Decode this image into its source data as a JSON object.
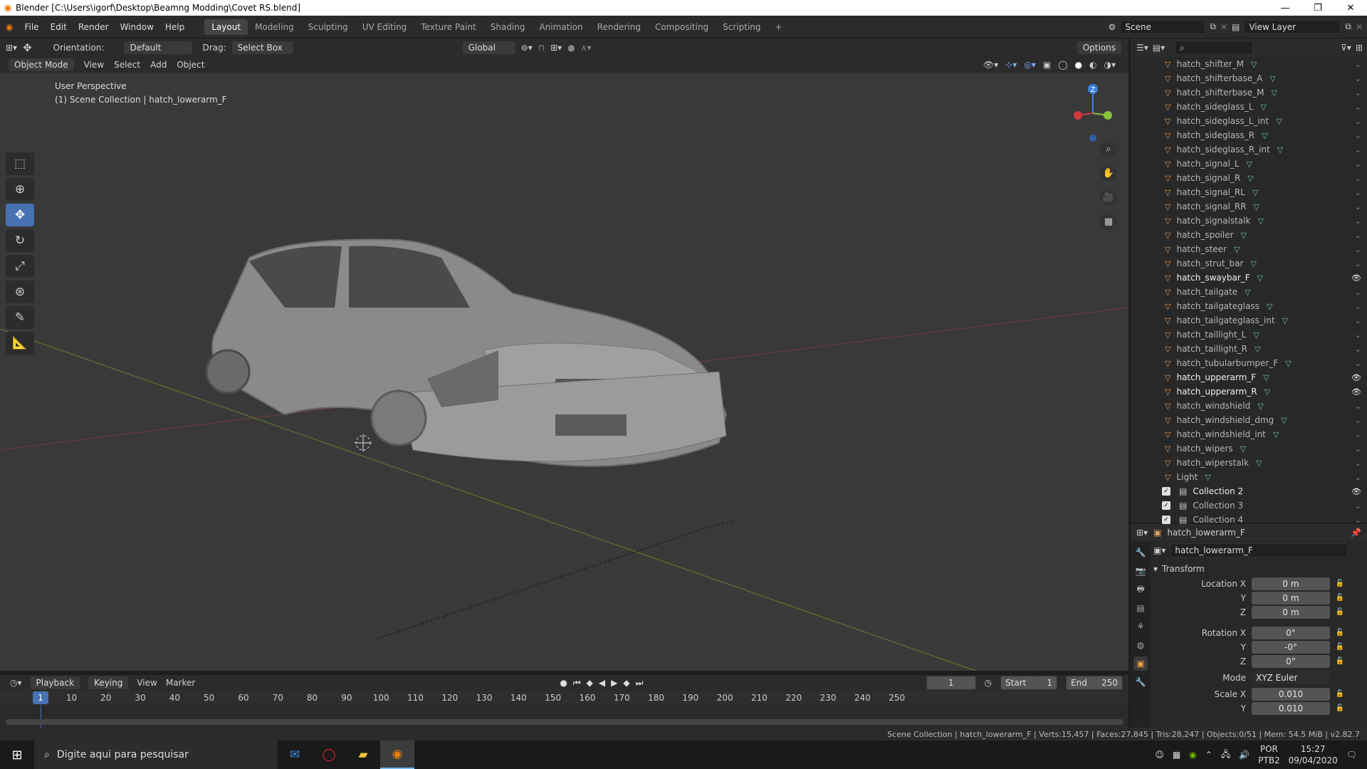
{
  "window": {
    "title": "Blender [C:\\Users\\igorf\\Desktop\\Beamng Modding\\Covet RS.blend]",
    "minimize": "—",
    "maximize": "❐",
    "close": "✕"
  },
  "menu": {
    "items": [
      "File",
      "Edit",
      "Render",
      "Window",
      "Help"
    ]
  },
  "workspaces": [
    "Layout",
    "Modeling",
    "Sculpting",
    "UV Editing",
    "Texture Paint",
    "Shading",
    "Animation",
    "Rendering",
    "Compositing",
    "Scripting"
  ],
  "active_workspace": "Layout",
  "add_workspace": "+",
  "scene": {
    "name": "Scene",
    "view_layer": "View Layer"
  },
  "toolbar": {
    "orientation_label": "Orientation:",
    "orientation_value": "Default",
    "drag_label": "Drag:",
    "drag_value": "Select Box",
    "transform": "Global",
    "options": "Options"
  },
  "header2": {
    "mode": "Object Mode",
    "items": [
      "View",
      "Select",
      "Add",
      "Object"
    ]
  },
  "viewport": {
    "perspective": "User Perspective",
    "collection_info": "(1) Scene Collection | hatch_lowerarm_F",
    "axes": {
      "z": "Z"
    }
  },
  "outliner": {
    "items": [
      {
        "name": "hatch_shifter_M",
        "visible": false
      },
      {
        "name": "hatch_shifterbase_A",
        "visible": false
      },
      {
        "name": "hatch_shifterbase_M",
        "visible": false
      },
      {
        "name": "hatch_sideglass_L",
        "visible": false
      },
      {
        "name": "hatch_sideglass_L_int",
        "visible": false
      },
      {
        "name": "hatch_sideglass_R",
        "visible": false
      },
      {
        "name": "hatch_sideglass_R_int",
        "visible": false
      },
      {
        "name": "hatch_signal_L",
        "visible": false
      },
      {
        "name": "hatch_signal_R",
        "visible": false
      },
      {
        "name": "hatch_signal_RL",
        "visible": false
      },
      {
        "name": "hatch_signal_RR",
        "visible": false
      },
      {
        "name": "hatch_signalstalk",
        "visible": false
      },
      {
        "name": "hatch_spoiler",
        "visible": false
      },
      {
        "name": "hatch_steer",
        "visible": false
      },
      {
        "name": "hatch_strut_bar",
        "visible": false
      },
      {
        "name": "hatch_swaybar_F",
        "visible": true
      },
      {
        "name": "hatch_tailgate",
        "visible": false
      },
      {
        "name": "hatch_tailgateglass",
        "visible": false
      },
      {
        "name": "hatch_tailgateglass_int",
        "visible": false
      },
      {
        "name": "hatch_taillight_L",
        "visible": false
      },
      {
        "name": "hatch_taillight_R",
        "visible": false
      },
      {
        "name": "hatch_tubularbumper_F",
        "visible": false
      },
      {
        "name": "hatch_upperarm_F",
        "visible": true
      },
      {
        "name": "hatch_upperarm_R",
        "visible": true
      },
      {
        "name": "hatch_windshield",
        "visible": false
      },
      {
        "name": "hatch_windshield_dmg",
        "visible": false
      },
      {
        "name": "hatch_windshield_int",
        "visible": false
      },
      {
        "name": "hatch_wipers",
        "visible": false
      },
      {
        "name": "hatch_wiperstalk",
        "visible": false
      },
      {
        "name": "Light",
        "visible": false
      }
    ],
    "collections": [
      "Collection 2",
      "Collection 3",
      "Collection 4"
    ]
  },
  "properties": {
    "object_name": "hatch_lowerarm_F",
    "panel": "Transform",
    "location": {
      "label": "Location X",
      "x": "0 m",
      "y": "0 m",
      "z": "0 m"
    },
    "rotation": {
      "label": "Rotation X",
      "x": "0°",
      "y": "-0°",
      "z": "0°"
    },
    "mode_label": "Mode",
    "mode": "XYZ Euler",
    "scale": {
      "label": "Scale X",
      "x": "0.010",
      "y": "0.010"
    },
    "axis_y": "Y",
    "axis_z": "Z"
  },
  "timeline": {
    "menus": [
      "Playback",
      "Keying",
      "View",
      "Marker"
    ],
    "current_frame": "1",
    "start_label": "Start",
    "start": "1",
    "end_label": "End",
    "end": "250",
    "ticks": [
      "10",
      "20",
      "30",
      "40",
      "50",
      "60",
      "70",
      "80",
      "90",
      "100",
      "110",
      "120",
      "130",
      "140",
      "150",
      "160",
      "170",
      "180",
      "190",
      "200",
      "210",
      "220",
      "230",
      "240",
      "250"
    ]
  },
  "status": "Scene Collection | hatch_lowerarm_F | Verts:15,457 | Faces:27,845 | Tris:28,247 | Objects:0/51 | Mem: 54.5 MiB | v2.82.7",
  "taskbar": {
    "search": "Digite aqui para pesquisar",
    "lang1": "POR",
    "lang2": "PTB2",
    "time": "15:27",
    "date": "09/04/2020"
  }
}
